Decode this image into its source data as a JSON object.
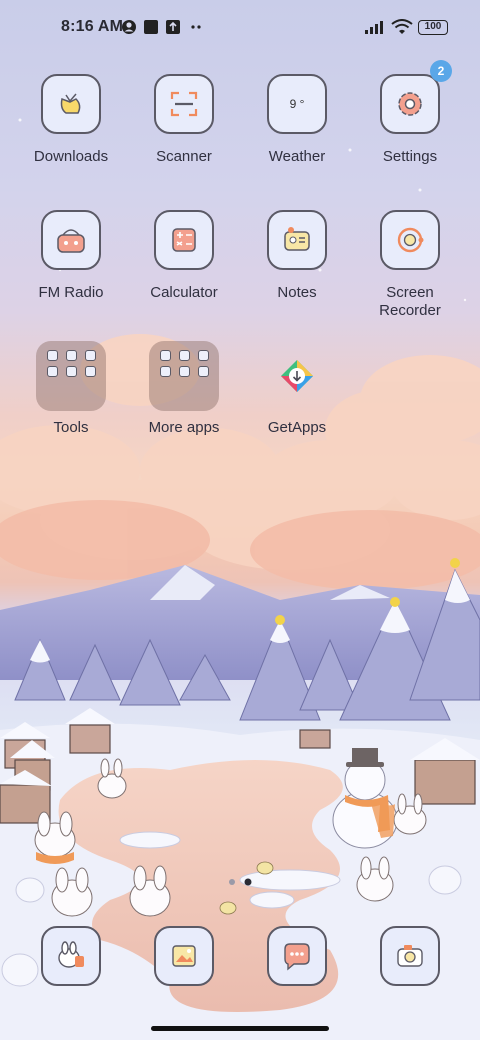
{
  "status_bar": {
    "time": "8:16 AM",
    "battery": "100",
    "icons": [
      "account-icon",
      "app-square-icon",
      "upload-icon",
      "more-dots-icon",
      "signal-icon",
      "wifi-icon",
      "battery-icon"
    ]
  },
  "home": {
    "rows": [
      [
        {
          "label": "Downloads",
          "icon": "downloads-icon"
        },
        {
          "label": "Scanner",
          "icon": "scanner-icon"
        },
        {
          "label": "Weather",
          "icon": "weather-icon",
          "text": "9 °"
        },
        {
          "label": "Settings",
          "icon": "settings-icon",
          "badge": "2"
        }
      ],
      [
        {
          "label": "FM Radio",
          "icon": "radio-icon"
        },
        {
          "label": "Calculator",
          "icon": "calculator-icon"
        },
        {
          "label": "Notes",
          "icon": "notes-icon"
        },
        {
          "label_line1": "Screen",
          "label_line2": "Recorder",
          "icon": "screen-recorder-icon"
        }
      ],
      [
        {
          "label": "Tools",
          "icon": "folder-icon"
        },
        {
          "label": "More apps",
          "icon": "folder-icon"
        },
        {
          "label": "GetApps",
          "icon": "getapps-icon"
        }
      ]
    ]
  },
  "pager": {
    "pages": 2,
    "current": 2
  },
  "dock": [
    "phone-icon",
    "gallery-icon",
    "messages-icon",
    "camera-icon"
  ],
  "colors": {
    "icon_tile": "#e8ecfb",
    "icon_outline": "#5b5a66",
    "accent_orange": "#f08a5d",
    "badge": "#5aa7e8"
  }
}
